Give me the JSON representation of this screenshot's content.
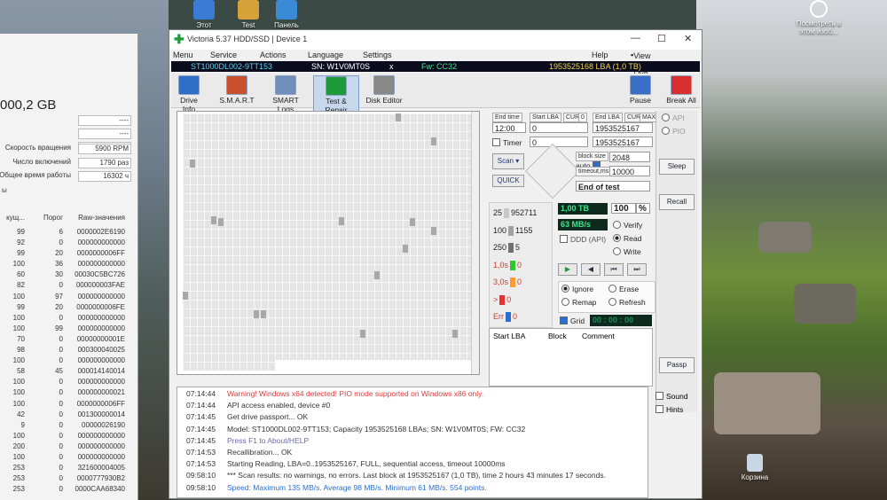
{
  "desktop": {
    "icons": [
      {
        "label": "Этот",
        "color": "#3a7bd5"
      },
      {
        "label": "Test",
        "color": "#d5a23a"
      },
      {
        "label": "Панель",
        "color": "#3a8ad5"
      }
    ],
    "right_icon_label": "Посмотреть в этом изоб...",
    "recycle_label": "Корзина"
  },
  "bgwin": {
    "capacity": "000,2 GB",
    "rows": [
      {
        "label": "",
        "value": "----"
      },
      {
        "label": "",
        "value": "----"
      },
      {
        "label": "",
        "value": "----"
      },
      {
        "label": "Скорость вращения",
        "value": "5900 RPM"
      },
      {
        "label": "Число включений",
        "value": "1790 раз"
      },
      {
        "label": "Общее время работы",
        "value": "16302 ч"
      }
    ],
    "note": "ы",
    "headers": {
      "col1": "кущ...",
      "col2": "Порог",
      "col3": "Raw-значения"
    },
    "smart_rows": [
      [
        "99",
        "6",
        "0000002E6190"
      ],
      [
        "92",
        "0",
        "000000000000"
      ],
      [
        "99",
        "20",
        "0000000006FF"
      ],
      [
        "100",
        "36",
        "000000000000"
      ],
      [
        "60",
        "30",
        "00030C5BC726"
      ],
      [
        "82",
        "0",
        "000000003FAE"
      ],
      [
        "100",
        "97",
        "000000000000"
      ],
      [
        "99",
        "20",
        "0000000006FE"
      ],
      [
        "100",
        "0",
        "000000000000"
      ],
      [
        "100",
        "99",
        "000000000000"
      ],
      [
        "70",
        "0",
        "00000000001E"
      ],
      [
        "98",
        "0",
        "000300040025"
      ],
      [
        "100",
        "0",
        "000000000000"
      ],
      [
        "58",
        "45",
        "000014140014"
      ],
      [
        "100",
        "0",
        "000000000000"
      ],
      [
        "100",
        "0",
        "000000000021"
      ],
      [
        "100",
        "0",
        "0000000006FF"
      ],
      [
        "42",
        "0",
        "001300000014"
      ],
      [
        "9",
        "0",
        "00000026190"
      ],
      [
        "100",
        "0",
        "000000000000"
      ],
      [
        "200",
        "0",
        "000000000000"
      ],
      [
        "100",
        "0",
        "000000000000"
      ],
      [
        "253",
        "0",
        "321600004005"
      ],
      [
        "253",
        "0",
        "0000777930B2"
      ],
      [
        "253",
        "0",
        "0000CAA68340"
      ]
    ]
  },
  "window": {
    "title": "Victoria 5.37 HDD/SSD | Device 1",
    "controls": {
      "min": "—",
      "max": "☐",
      "close": "✕"
    },
    "menu": [
      "Menu",
      "Service",
      "Actions",
      "Language",
      "Settings",
      "Help"
    ],
    "view_buffer": "View Buffer Live",
    "drive": {
      "model": "ST1000DL002-9TT153",
      "serial": "SN: W1V0MT0S",
      "x": "x",
      "fw": "Fw: CC32",
      "lba": "1953525168 LBA (1,0 TB)"
    },
    "toolbar": [
      {
        "label": "Drive Info",
        "color": "#2f6fc8"
      },
      {
        "label": "S.M.A.R.T",
        "color": "#c8502f"
      },
      {
        "label": "SMART Logs",
        "color": "#6f8fb8"
      },
      {
        "label": "Test & Repair",
        "color": "#1e9a3a"
      },
      {
        "label": "Disk Editor",
        "color": "#888888"
      }
    ],
    "pause_label": "Pause",
    "break_label": "Break All"
  },
  "panel": {
    "end_time_label": "End time",
    "start_lba_label": "Start LBA",
    "cur_label": "CUR",
    "zero_label": "0",
    "end_lba_label": "End LBA",
    "max_label": "MAX",
    "end_time": "12:00",
    "start_lba": "0",
    "end_lba": "1953525167",
    "timer_label": "Timer",
    "timer_value": "0",
    "end_lba2": "1953525167",
    "scan_label": "Scan",
    "quick_label": "QUICK",
    "block_size_label": "block size",
    "auto_label": "auto",
    "block_size": "2048",
    "timeout_label": "timeout,ms",
    "timeout": "10000",
    "end_of_test": "End of test",
    "blocks": [
      {
        "ms": "25",
        "count": "952711",
        "color": "#c8c8c8"
      },
      {
        "ms": "100",
        "count": "1155",
        "color": "#a0a0a0"
      },
      {
        "ms": "250",
        "count": "5",
        "color": "#707070"
      },
      {
        "ms": "1,0s",
        "count": "0",
        "color": "#2ec62e"
      },
      {
        "ms": "3,0s",
        "count": "0",
        "color": "#ff9a2e"
      },
      {
        "ms": ">",
        "count": "0",
        "color": "#e83030"
      },
      {
        "ms": "Err",
        "count": "0",
        "color": "#2a6fd0"
      }
    ],
    "progress_total": "1,00 TB",
    "progress_pct": "100",
    "pct_sign": "%",
    "speed": "63 MB/s",
    "ddd": "DDD (API)",
    "verify": "Verify",
    "read": "Read",
    "write": "Write",
    "ignore": "Ignore",
    "erase": "Erase",
    "remap": "Remap",
    "refresh": "Refresh",
    "grid": "Grid",
    "grid_time": "00 : 00 : 00",
    "table_headers": [
      "Start LBA",
      "Block",
      "Comment"
    ]
  },
  "side": {
    "api": "API",
    "pio": "PIO",
    "sleep": "Sleep",
    "recall": "Recall",
    "passp": "Passp",
    "sound": "Sound",
    "hints": "Hints"
  },
  "log": [
    {
      "time": "07:14:44",
      "text": "Warning! Windows x64 detected! PIO mode supported on Windows x86 only.",
      "color": "#e03a3a"
    },
    {
      "time": "07:14:44",
      "text": "API access enabled, device #0",
      "color": "#333333"
    },
    {
      "time": "07:14:45",
      "text": "Get drive passport... OK",
      "color": "#333333"
    },
    {
      "time": "07:14:45",
      "text": "Model: ST1000DL002-9TT153; Capacity 1953525168 LBAs; SN: W1V0MT0S; FW: CC32",
      "color": "#333333"
    },
    {
      "time": "07:14:45",
      "text": "Press F1 to About/HELP",
      "color": "#6a6aa8"
    },
    {
      "time": "07:14:53",
      "text": "Recallibration... OK",
      "color": "#333333"
    },
    {
      "time": "07:14:53",
      "text": "Starting Reading, LBA=0..1953525167, FULL, sequential access, timeout 10000ms",
      "color": "#333333"
    },
    {
      "time": "09:58:10",
      "text": "*** Scan results: no warnings, no errors. Last block at 1953525167 (1,0 TB), time 2 hours 43 minutes 17 seconds.",
      "color": "#333333"
    },
    {
      "time": "09:58:10",
      "text": "Speed: Maximum 135 MB/s. Average 98 MB/s. Minimum 61 MB/s. 554 points.",
      "color": "#2a6fd0"
    }
  ]
}
